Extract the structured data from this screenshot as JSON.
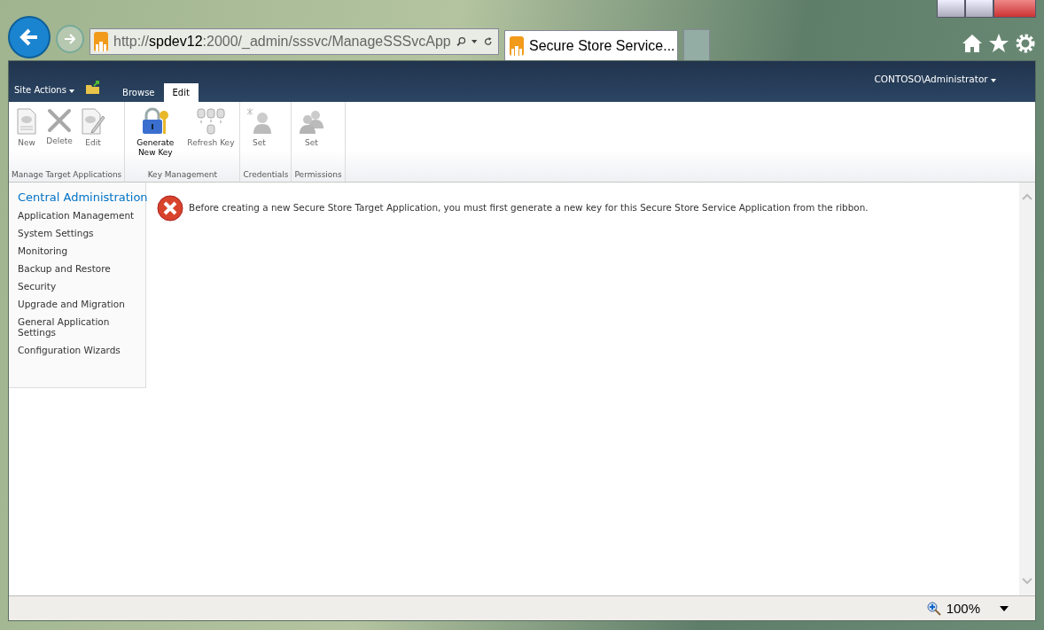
{
  "browser": {
    "address": {
      "prefix": "http://",
      "host": "spdev12",
      "rest": ":2000/_admin/sssvc/ManageSSSvcApp"
    },
    "tab": {
      "title": "Secure Store Service..."
    }
  },
  "header": {
    "user": "CONTOSO\\Administrator"
  },
  "site_actions": "Site Actions",
  "tabs": [
    {
      "label": "Browse",
      "selected": false
    },
    {
      "label": "Edit",
      "selected": true
    }
  ],
  "ribbon_groups": [
    {
      "name": "Manage Target Applications",
      "buttons": [
        {
          "label": "New",
          "kind": "document",
          "disabled": true
        },
        {
          "label": "Delete",
          "kind": "delete",
          "disabled": true
        },
        {
          "label": "Edit",
          "kind": "pencil",
          "disabled": true
        }
      ]
    },
    {
      "name": "Key Management",
      "buttons": [
        {
          "label": "Generate New Key",
          "kind": "lock",
          "disabled": false
        },
        {
          "label": "Refresh Key",
          "kind": "database",
          "disabled": true
        }
      ]
    },
    {
      "name": "Credentials",
      "buttons": [
        {
          "label": "Set",
          "kind": "person",
          "disabled": true
        }
      ]
    },
    {
      "name": "Permissions",
      "buttons": [
        {
          "label": "Set",
          "kind": "people",
          "disabled": true
        }
      ]
    }
  ],
  "nav": {
    "heading": "Central Administration",
    "items": [
      "Application Management",
      "System Settings",
      "Monitoring",
      "Backup and Restore",
      "Security",
      "Upgrade and Migration",
      "General Application Settings",
      "Configuration Wizards"
    ]
  },
  "message": "Before creating a new Secure Store Target Application, you must first generate a new key for this Secure Store Service Application from the ribbon.",
  "status_bar": {
    "zoom": "100%"
  }
}
